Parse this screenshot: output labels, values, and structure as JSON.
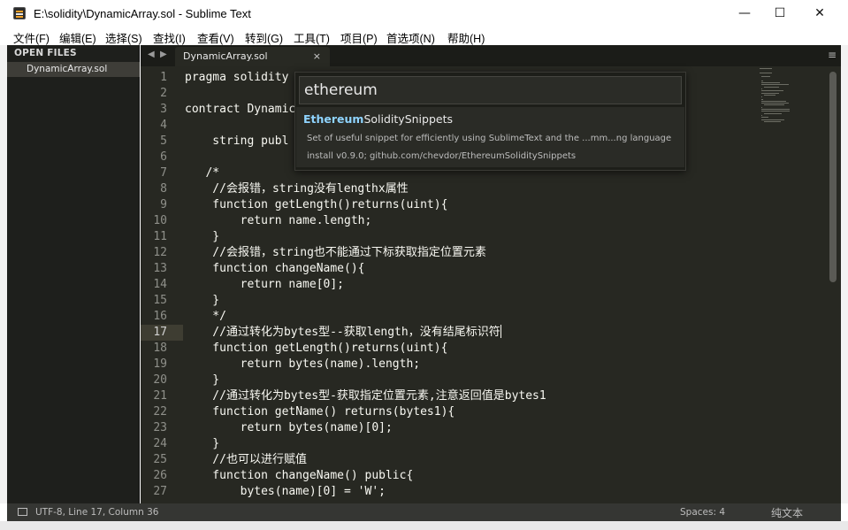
{
  "window": {
    "title": "E:\\solidity\\DynamicArray.sol - Sublime Text",
    "minimize_glyph": "—",
    "maximize_glyph": "☐",
    "close_glyph": "✕"
  },
  "menu": [
    "文件(F)",
    "编辑(E)",
    "选择(S)",
    "查找(I)",
    "查看(V)",
    "转到(G)",
    "工具(T)",
    "项目(P)",
    "首选项(N)",
    "帮助(H)"
  ],
  "sidebar": {
    "header": "OPEN FILES",
    "files": [
      "DynamicArray.sol"
    ]
  },
  "tabs": {
    "prev_glyph": "◀",
    "next_glyph": "▶",
    "active": "DynamicArray.sol",
    "close_glyph": "×",
    "menu_glyph": "≡"
  },
  "editor": {
    "current_line": 17,
    "lines": [
      {
        "n": "1",
        "text": "pragma solidity"
      },
      {
        "n": "2",
        "text": ""
      },
      {
        "n": "3",
        "text": "contract Dynamic"
      },
      {
        "n": "4",
        "text": ""
      },
      {
        "n": "5",
        "text": "    string publ"
      },
      {
        "n": "6",
        "text": ""
      },
      {
        "n": "7",
        "text": "   /*"
      },
      {
        "n": "8",
        "text": "    //会报错，string没有lengthx属性"
      },
      {
        "n": "9",
        "text": "    function getLength()returns(uint){"
      },
      {
        "n": "10",
        "text": "        return name.length;"
      },
      {
        "n": "11",
        "text": "    }"
      },
      {
        "n": "12",
        "text": "    //会报错，string也不能通过下标获取指定位置元素"
      },
      {
        "n": "13",
        "text": "    function changeName(){"
      },
      {
        "n": "14",
        "text": "        return name[0];"
      },
      {
        "n": "15",
        "text": "    }"
      },
      {
        "n": "16",
        "text": "    */"
      },
      {
        "n": "17",
        "text": "    //通过转化为bytes型--获取length，没有结尾标识符"
      },
      {
        "n": "18",
        "text": "    function getLength()returns(uint){"
      },
      {
        "n": "19",
        "text": "        return bytes(name).length;"
      },
      {
        "n": "20",
        "text": "    }"
      },
      {
        "n": "21",
        "text": "    //通过转化为bytes型-获取指定位置元素,注意返回值是bytes1"
      },
      {
        "n": "22",
        "text": "    function getName() returns(bytes1){"
      },
      {
        "n": "23",
        "text": "        return bytes(name)[0];"
      },
      {
        "n": "24",
        "text": "    }"
      },
      {
        "n": "25",
        "text": "    //也可以进行赋值"
      },
      {
        "n": "26",
        "text": "    function changeName() public{"
      },
      {
        "n": "27",
        "text": "        bytes(name)[0] = 'W';"
      }
    ]
  },
  "palette": {
    "query": "ethereum",
    "result_match": "Ethereum",
    "result_rest": "SoliditySnippets",
    "description": "Set of useful snippet for efficiently using SublimeText and the ...mm...ng language",
    "install": "install v0.9.0; github.com/chevdor/EthereumSoliditySnippets"
  },
  "status": {
    "position": "UTF-8, Line 17, Column 36",
    "spaces": "Spaces: 4",
    "syntax": "纯文本"
  },
  "colors": {
    "editor_bg": "#272822",
    "sidebar_bg": "#1e1f1c",
    "match_highlight": "#8fd4ff"
  }
}
